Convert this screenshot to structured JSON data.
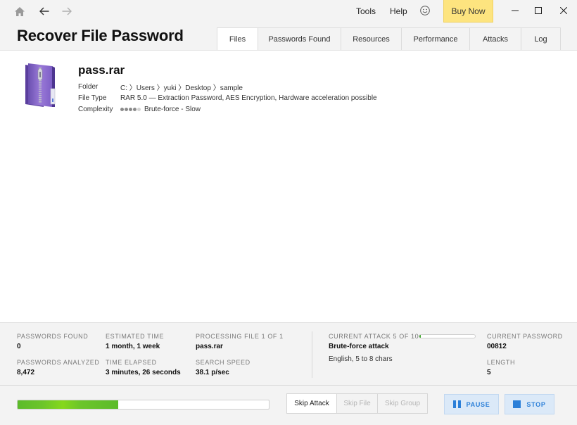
{
  "titlebar": {
    "nav": {
      "home_icon": "home-icon",
      "back_icon": "arrow-left-icon",
      "forward_icon": "arrow-right-icon"
    },
    "menus": [
      "Tools",
      "Help"
    ],
    "feedback_icon": "smiley-icon",
    "buy_now_label": "Buy Now",
    "buy_now_color": "#fde47f"
  },
  "header": {
    "title": "Recover File Password",
    "tabs": [
      {
        "label": "Files",
        "active": true
      },
      {
        "label": "Passwords Found",
        "active": false
      },
      {
        "label": "Resources",
        "active": false
      },
      {
        "label": "Performance",
        "active": false
      },
      {
        "label": "Attacks",
        "active": false
      },
      {
        "label": "Log",
        "active": false
      }
    ]
  },
  "file": {
    "icon": "rar-archive-icon",
    "name": "pass.rar",
    "fields": [
      {
        "label": "Folder",
        "value": "C: 〉Users 〉yuki 〉Desktop 〉sample"
      },
      {
        "label": "File Type",
        "value": "RAR 5.0 — Extraction Password, AES Encryption, Hardware acceleration possible"
      },
      {
        "label": "Complexity",
        "value": "Brute-force - Slow"
      }
    ],
    "complexity_level": 4,
    "complexity_max": 5
  },
  "stats": {
    "passwords_found": {
      "label": "PASSWORDS FOUND",
      "value": "0"
    },
    "passwords_analyzed": {
      "label": "PASSWORDS ANALYZED",
      "value": "8,472"
    },
    "estimated_time": {
      "label": "ESTIMATED TIME",
      "value": "1 month, 1 week"
    },
    "time_elapsed": {
      "label": "TIME ELAPSED",
      "value": "3 minutes, 26 seconds"
    },
    "processing_file": {
      "label": "PROCESSING FILE 1 OF 1",
      "value": "pass.rar"
    },
    "search_speed": {
      "label": "SEARCH SPEED",
      "value": "38.1 p/sec"
    },
    "current_attack": {
      "label": "CURRENT ATTACK 5 OF 10",
      "value": "Brute-force attack",
      "detail": "English, 5 to 8 chars",
      "progress_percent": 3
    },
    "current_password": {
      "label": "CURRENT PASSWORD",
      "value": "00812"
    },
    "length": {
      "label": "LENGTH",
      "value": "5"
    }
  },
  "actions": {
    "overall_progress_percent": 40,
    "progress_color": "#6cc52a",
    "skip_attack": "Skip Attack",
    "skip_file": "Skip File",
    "skip_group": "Skip Group",
    "pause": "PAUSE",
    "stop": "STOP",
    "control_color": "#2b7fd8"
  }
}
